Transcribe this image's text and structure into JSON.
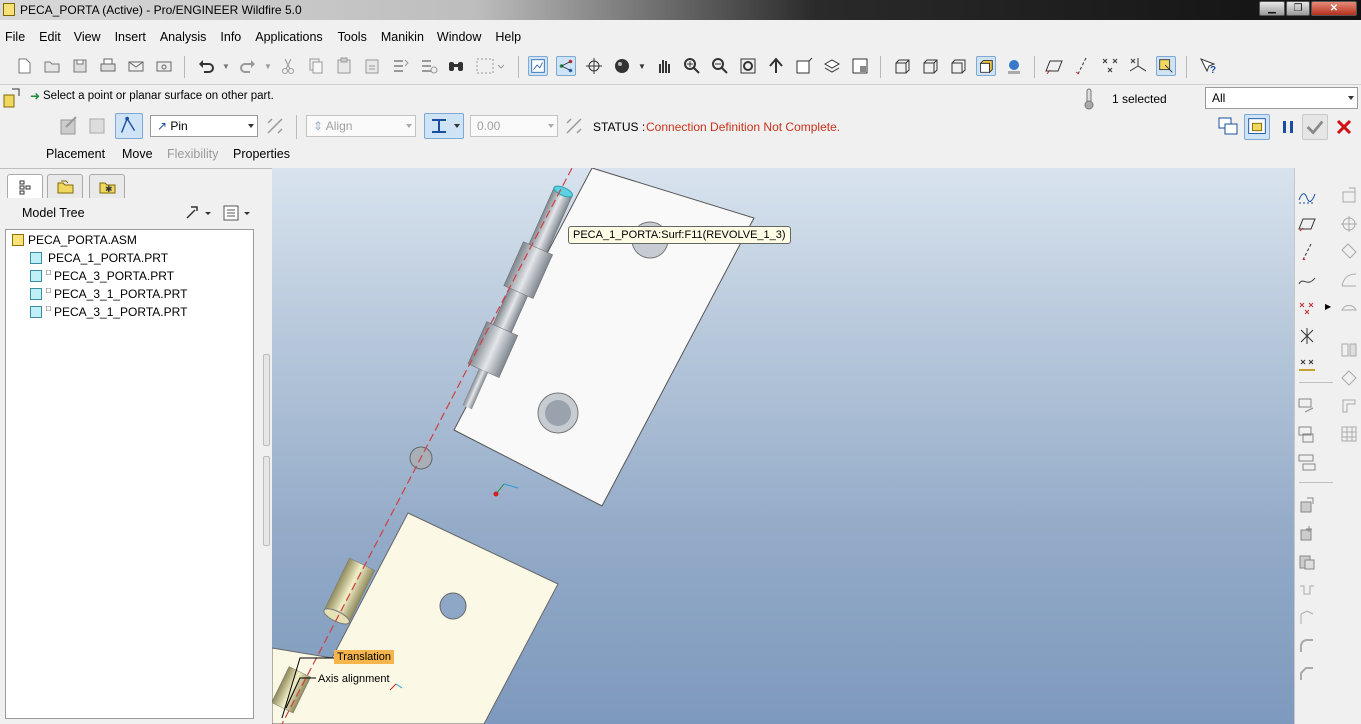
{
  "window": {
    "title": "PECA_PORTA (Active) - Pro/ENGINEER Wildfire 5.0",
    "controls": [
      "minimize",
      "maximize",
      "close"
    ]
  },
  "menu": [
    "File",
    "Edit",
    "View",
    "Insert",
    "Analysis",
    "Info",
    "Applications",
    "Tools",
    "Manikin",
    "Window",
    "Help"
  ],
  "toolbar": {
    "icons": [
      "new-icon",
      "open-icon",
      "save-icon",
      "print-icon",
      "email-icon",
      "email-link-icon",
      "undo-icon",
      "redo-icon",
      "cut-icon",
      "copy-icon",
      "paste-icon",
      "paste-special-icon",
      "regenerate-icon",
      "regen-manager-icon",
      "find-icon",
      "select-box-icon",
      "datum-display-icon",
      "spin-center-icon",
      "orient-icon",
      "appearance-icon",
      "pan-icon",
      "zoom-in-icon",
      "zoom-out-icon",
      "refit-icon",
      "reorient-icon",
      "saved-views-icon",
      "layers-icon",
      "view-manager-icon",
      "wireframe-icon",
      "hidden-line-icon",
      "no-hidden-icon",
      "shading-icon",
      "enhanced-realism-icon",
      "datum-planes-icon",
      "datum-axes-icon",
      "datum-points-icon",
      "coordinate-systems-icon",
      "annotations-icon",
      "context-help-icon"
    ]
  },
  "dashboard": {
    "prompt": "Select a point or planar surface on other part.",
    "selected_count": "1 selected",
    "filter": "All",
    "connection_type": "Pin",
    "constraint_type": "Align",
    "offset_value": "0.00",
    "status_label": "STATUS :",
    "status_text": "Connection Definition Not Complete.",
    "tabs": [
      "Placement",
      "Move",
      "Flexibility",
      "Properties"
    ],
    "colors": {
      "status_text": "#c8331b",
      "confirm": "#3a3a3a",
      "cancel": "#d01010",
      "pause": "#1a4ea0"
    }
  },
  "model_tree": {
    "header": "Model Tree",
    "items": [
      {
        "label": "PECA_PORTA.ASM",
        "type": "asm"
      },
      {
        "label": "PECA_1_PORTA.PRT",
        "type": "prt"
      },
      {
        "label": "PECA_3_PORTA.PRT",
        "type": "prt"
      },
      {
        "label": "PECA_3_1_PORTA.PRT",
        "type": "prt"
      },
      {
        "label": "PECA_3_1_PORTA.PRT",
        "type": "prt"
      }
    ]
  },
  "graphics": {
    "tooltip": "PECA_1_PORTA:Surf:F11(REVOLVE_1_3)",
    "labels": {
      "translation": "Translation",
      "axis_alignment": "Axis alignment"
    },
    "colors": {
      "plate": "#f9f9f9",
      "plate2": "#fbf8e6",
      "pin": "#b8bec6",
      "axis": "#d04040"
    }
  },
  "right_toolbar": {
    "icons": [
      "sketch-tool-icon",
      "datum-plane-icon",
      "datum-axis-icon",
      "datum-curve-icon",
      "datum-point-icon",
      "offset-csys-point-icon",
      "field-point-icon",
      "analysis-icon",
      "component-place-icon",
      "component-create-icon",
      "mirror-component-icon",
      "repeat-icon",
      "package-icon",
      "cut-out-icon",
      "flexible-icon",
      "hole-icon",
      "round-icon",
      "chamfer-icon",
      "pattern-icon"
    ]
  }
}
